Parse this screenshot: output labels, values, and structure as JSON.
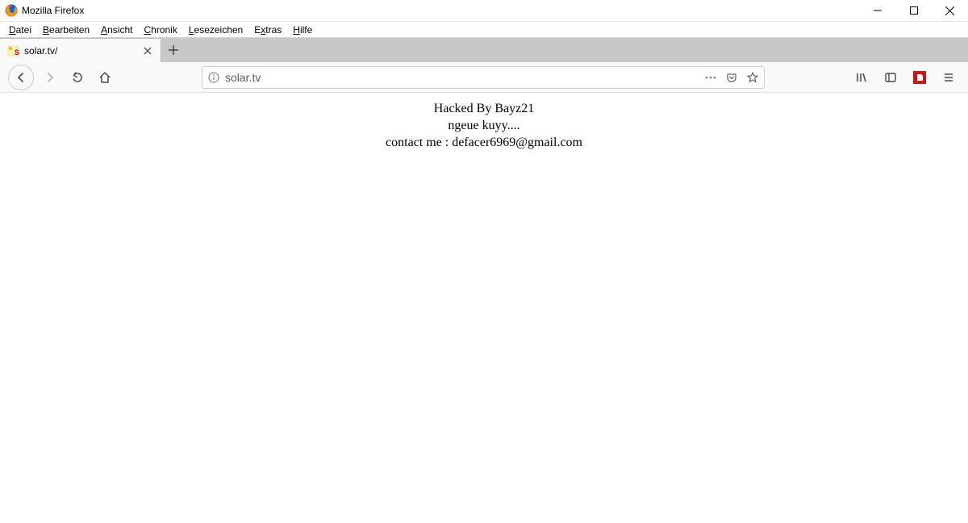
{
  "window": {
    "title": "Mozilla Firefox"
  },
  "menu": {
    "datei": "Datei",
    "bearbeiten": "Bearbeiten",
    "ansicht": "Ansicht",
    "chronik": "Chronik",
    "lesezeichen": "Lesezeichen",
    "extras": "Extras",
    "hilfe": "Hilfe"
  },
  "tab": {
    "title": "solar.tv/"
  },
  "url": {
    "text": "solar.tv"
  },
  "page": {
    "line1": "Hacked By Bayz21",
    "line2": "ngeue kuyy....",
    "line3": "contact me : defacer6969@gmail.com"
  }
}
